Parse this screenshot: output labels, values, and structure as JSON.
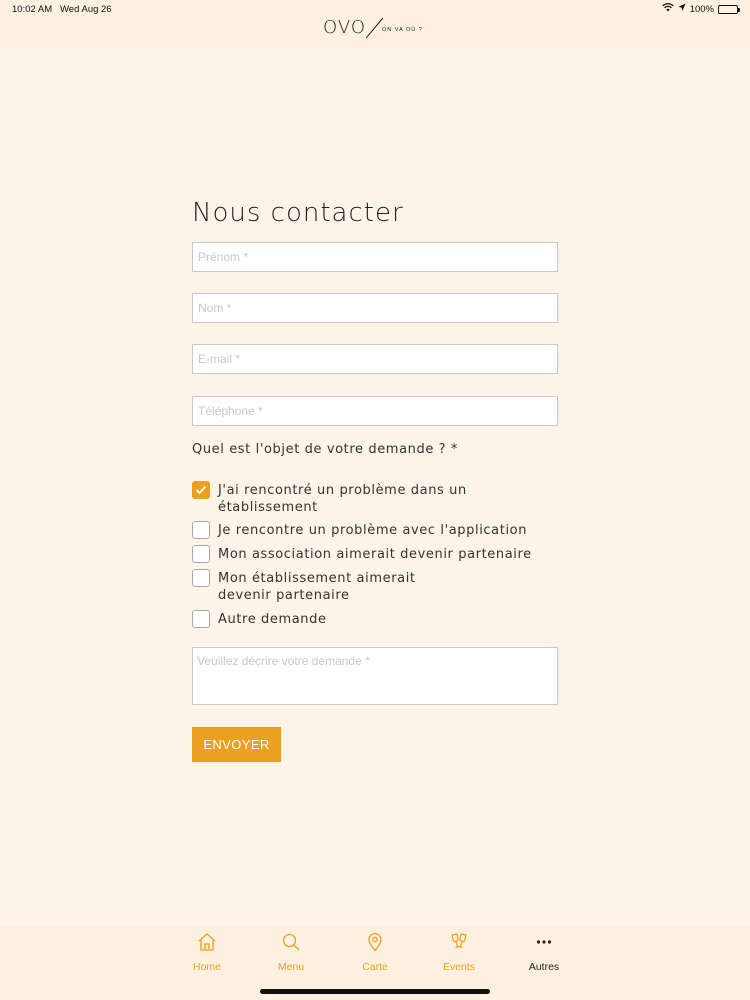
{
  "status_bar": {
    "time": "10:02 AM",
    "date": "Wed Aug 26",
    "battery_text": "100%",
    "battery_level": 1.0
  },
  "logo": {
    "main": "OVO",
    "tagline": "ON VA OÙ ?"
  },
  "form": {
    "title": "Nous contacter",
    "fields": [
      {
        "name": "prenom",
        "placeholder": "Prénom *",
        "value": ""
      },
      {
        "name": "nom",
        "placeholder": "Nom *",
        "value": ""
      },
      {
        "name": "email",
        "placeholder": "E-mail *",
        "value": ""
      },
      {
        "name": "telephone",
        "placeholder": "Téléphone *",
        "value": ""
      }
    ],
    "question": "Quel est l'objet de votre demande ? *",
    "options": [
      {
        "label": "J'ai rencontré un problème dans un établissement",
        "checked": true
      },
      {
        "label": "Je rencontre un problème avec l'application",
        "checked": false
      },
      {
        "label": "Mon association aimerait devenir partenaire",
        "checked": false
      },
      {
        "label": "Mon établissement aimerait devenir partenaire",
        "checked": false
      },
      {
        "label": "Autre demande",
        "checked": false
      }
    ],
    "description_placeholder": "Veuillez décrire votre demande *",
    "submit_label": "ENVOYER"
  },
  "tabbar": {
    "items": [
      {
        "label": "Home",
        "icon": "home-icon",
        "active": true
      },
      {
        "label": "Menu",
        "icon": "search-icon",
        "active": true
      },
      {
        "label": "Carte",
        "icon": "map-pin-icon",
        "active": true
      },
      {
        "label": "Events",
        "icon": "champagne-glasses-icon",
        "active": true
      },
      {
        "label": "Autres",
        "icon": "more-dots-icon",
        "active": false
      }
    ]
  },
  "colors": {
    "accent": "#eba11f",
    "background": "#fdf3e8"
  }
}
